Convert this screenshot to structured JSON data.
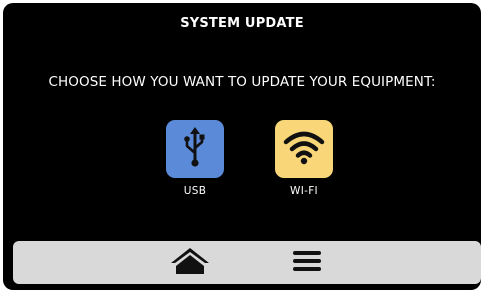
{
  "header": {
    "title": "SYSTEM UPDATE"
  },
  "main": {
    "prompt": "CHOOSE HOW YOU WANT TO UPDATE YOUR EQUIPMENT:",
    "options": [
      {
        "label": "USB",
        "icon": "usb-icon",
        "tile_color": "#5b8ad8"
      },
      {
        "label": "WI-FI",
        "icon": "wifi-icon",
        "tile_color": "#f9d778"
      }
    ]
  },
  "bottom_bar": {
    "home_icon": "home-icon",
    "menu_icon": "menu-icon",
    "background": "#d9d9d9"
  },
  "colors": {
    "screen_background": "#000000",
    "text": "#ffffff",
    "icon_dark": "#111111"
  }
}
